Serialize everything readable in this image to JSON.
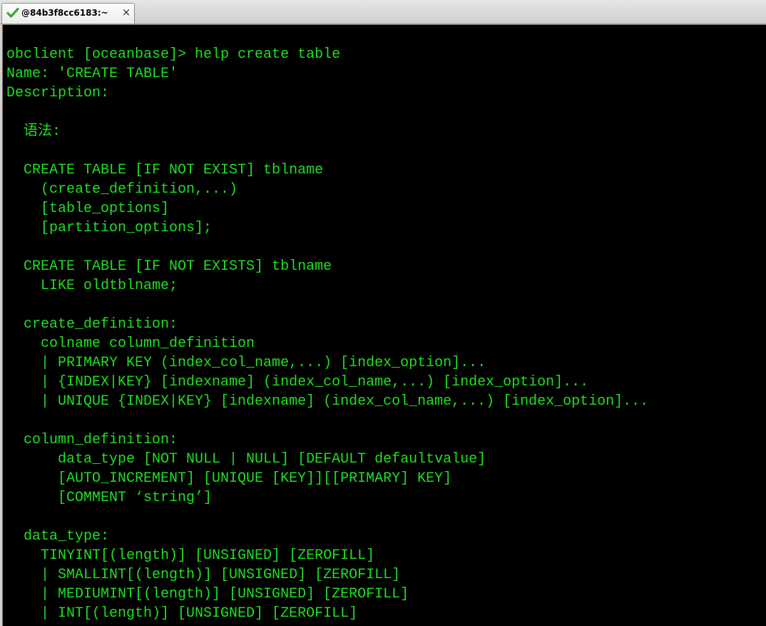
{
  "tab": {
    "title": "@84b3f8cc6183:~",
    "close_glyph": "×",
    "status_icon": "check-icon"
  },
  "colors": {
    "terminal_background": "#000000",
    "terminal_text": "#1ee01e",
    "status_check": "#3aa832"
  },
  "terminal": {
    "lines": [
      "obclient [oceanbase]> help create table",
      "Name: 'CREATE TABLE'",
      "Description:",
      "",
      "  语法:",
      "",
      "  CREATE TABLE [IF NOT EXIST] tblname",
      "    (create_definition,...)",
      "    [table_options]",
      "    [partition_options];",
      "",
      "  CREATE TABLE [IF NOT EXISTS] tblname",
      "    LIKE oldtblname;",
      "",
      "  create_definition:",
      "    colname column_definition",
      "    | PRIMARY KEY (index_col_name,...) [index_option]...",
      "    | {INDEX|KEY} [indexname] (index_col_name,...) [index_option]...",
      "    | UNIQUE {INDEX|KEY} [indexname] (index_col_name,...) [index_option]...",
      "",
      "  column_definition:",
      "      data_type [NOT NULL | NULL] [DEFAULT defaultvalue]",
      "      [AUTO_INCREMENT] [UNIQUE [KEY]][[PRIMARY] KEY]",
      "      [COMMENT ‘string’]",
      "",
      "  data_type:",
      "    TINYINT[(length)] [UNSIGNED] [ZEROFILL]",
      "    | SMALLINT[(length)] [UNSIGNED] [ZEROFILL]",
      "    | MEDIUMINT[(length)] [UNSIGNED] [ZEROFILL]",
      "    | INT[(length)] [UNSIGNED] [ZEROFILL]"
    ]
  }
}
